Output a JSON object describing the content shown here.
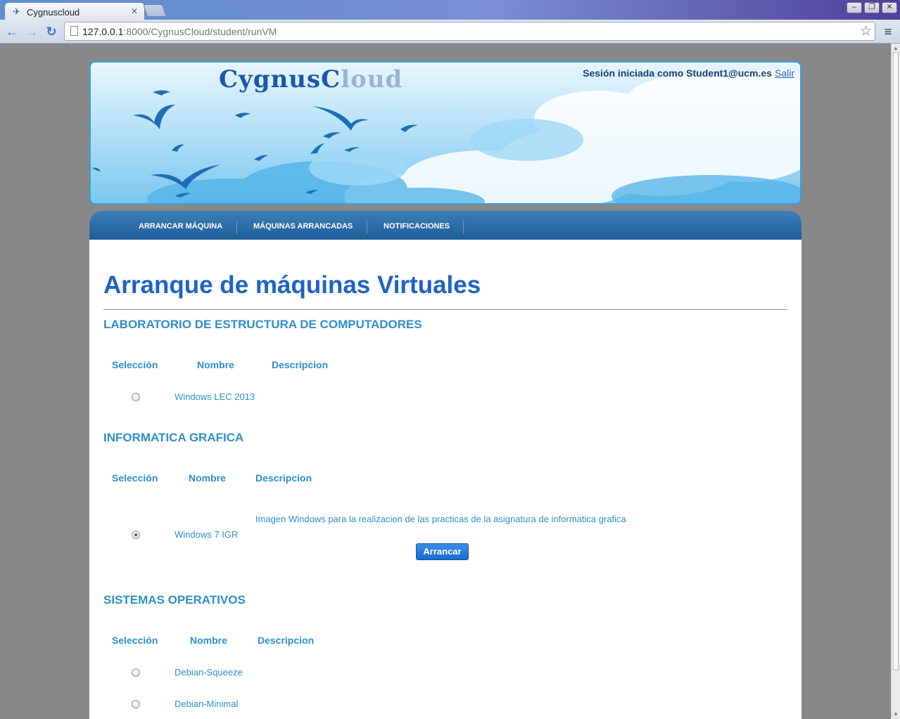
{
  "browser": {
    "tab_title": "Cygnuscloud",
    "url_host": "127.0.0.1",
    "url_rest": ":8000/CygnusCloud/student/runVM",
    "icons": [
      "back-icon",
      "forward-icon",
      "reload-icon",
      "bookmark-star-icon",
      "menu-icon",
      "minimize-icon",
      "maximize-icon",
      "close-icon"
    ]
  },
  "header": {
    "logo_dark": "CygnusC",
    "logo_light": "loud",
    "session_text": "Sesión iniciada como Student1@ucm.es",
    "logout_link": "Salir"
  },
  "nav": {
    "items": [
      {
        "label": "ARRANCAR MÁQUINA"
      },
      {
        "label": "MÁQUINAS ARRANCADAS"
      },
      {
        "label": "NOTIFICACIONES"
      }
    ]
  },
  "main": {
    "title": "Arranque de máquinas Virtuales",
    "columns": {
      "selection": "Selección",
      "name": "Nombre",
      "description": "Descripcion"
    },
    "sections": [
      {
        "title": "LABORATORIO DE ESTRUCTURA DE COMPUTADORES",
        "rows": [
          {
            "name": "Windows LEC 2013",
            "description": "",
            "selected": false
          }
        ]
      },
      {
        "title": "INFORMATICA GRAFICA",
        "rows": [
          {
            "name": "Windows 7 IGR",
            "description": "Imagen Windows para la realizacion de las practicas de la asignatura de informatica grafica",
            "selected": true
          }
        ],
        "button": "Arrancar"
      },
      {
        "title": "SISTEMAS OPERATIVOS",
        "rows": [
          {
            "name": "Debian-Squeeze",
            "description": "",
            "selected": false
          },
          {
            "name": "Debian-Minimal",
            "description": "",
            "selected": false
          }
        ]
      }
    ]
  },
  "colors": {
    "title_blue": "#1d63c7",
    "section_blue": "#2f8fcf",
    "nav_blue": "#1f5e99",
    "page_bg": "#888888"
  }
}
